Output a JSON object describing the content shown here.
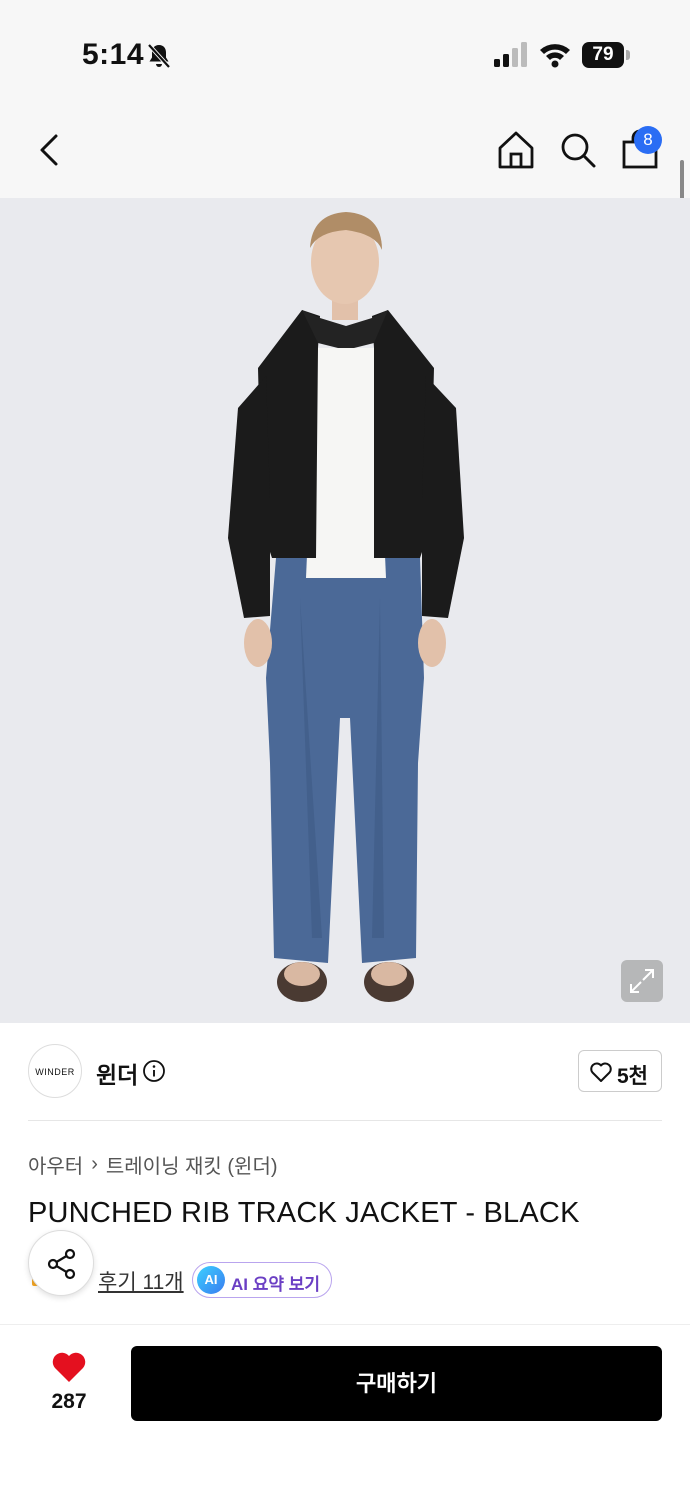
{
  "status_bar": {
    "time": "5:14",
    "battery": "79"
  },
  "nav": {
    "cart_count": "8"
  },
  "brand": {
    "logo_text": "WINDER",
    "name": "윈더",
    "likes": "5천"
  },
  "breadcrumb": {
    "category": "아우터",
    "subcategory": "트레이닝 재킷 (윈더)"
  },
  "product": {
    "title": "PUNCHED RIB TRACK JACKET - BLACK"
  },
  "reviews": {
    "label": "후기 11개"
  },
  "ai_summary": {
    "logo": "AI",
    "label": "AI 요약 보기"
  },
  "bottom_bar": {
    "wish_count": "287",
    "buy_label": "구매하기"
  },
  "colors": {
    "accent_badge": "#2a6df4",
    "buy_button": "#000000",
    "heart": "#e4101f",
    "ai_text": "#6b3fc4"
  }
}
